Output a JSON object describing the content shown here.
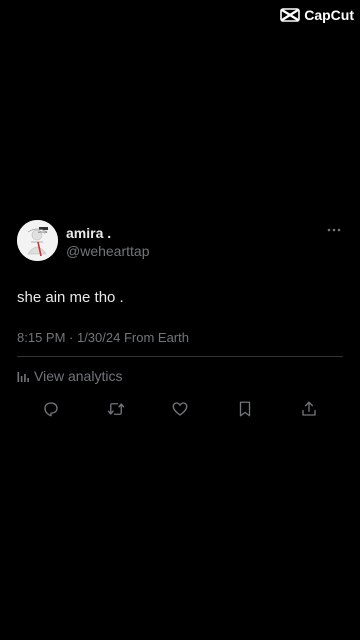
{
  "watermark": {
    "label": "CapCut",
    "icon": "capcut-logo-icon"
  },
  "post": {
    "avatar": {
      "icon": "avatar-image",
      "badge_text": "amiga"
    },
    "display_name": "amira .",
    "handle": "@wehearttap",
    "text": "she ain me tho .",
    "timestamp": "8:15 PM · 1/30/24 From Earth",
    "analytics_label": "View analytics"
  },
  "actions": [
    {
      "name": "reply",
      "icon": "reply-icon"
    },
    {
      "name": "repost",
      "icon": "repost-icon"
    },
    {
      "name": "like",
      "icon": "heart-icon"
    },
    {
      "name": "bookmark",
      "icon": "bookmark-icon"
    },
    {
      "name": "share",
      "icon": "share-icon"
    }
  ],
  "colors": {
    "background": "#000000",
    "primary_text": "#e7e9ea",
    "secondary_text": "#71767b",
    "divider": "#2f3336"
  }
}
